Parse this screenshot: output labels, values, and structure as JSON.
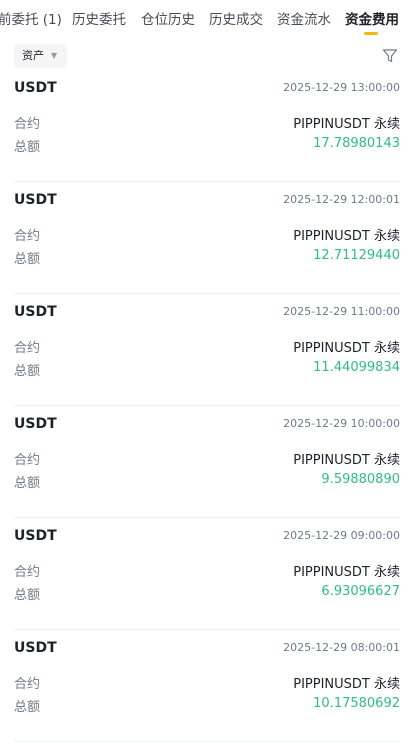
{
  "tabs": [
    {
      "label": "前委托 (1)"
    },
    {
      "label": "历史委托"
    },
    {
      "label": "仓位历史"
    },
    {
      "label": "历史成交"
    },
    {
      "label": "资金流水"
    },
    {
      "label": "资金费用",
      "active": true
    }
  ],
  "filter": {
    "label": "资产"
  },
  "labels": {
    "contract": "合约",
    "total": "总额"
  },
  "records": [
    {
      "asset": "USDT",
      "time": "2025-12-29 13:00:00",
      "contract": "PIPPINUSDT 永续",
      "amount": "17.78980143"
    },
    {
      "asset": "USDT",
      "time": "2025-12-29 12:00:01",
      "contract": "PIPPINUSDT 永续",
      "amount": "12.71129440"
    },
    {
      "asset": "USDT",
      "time": "2025-12-29 11:00:00",
      "contract": "PIPPINUSDT 永续",
      "amount": "11.44099834"
    },
    {
      "asset": "USDT",
      "time": "2025-12-29 10:00:00",
      "contract": "PIPPINUSDT 永续",
      "amount": "9.59880890"
    },
    {
      "asset": "USDT",
      "time": "2025-12-29 09:00:00",
      "contract": "PIPPINUSDT 永续",
      "amount": "6.93096627"
    },
    {
      "asset": "USDT",
      "time": "2025-12-29 08:00:01",
      "contract": "PIPPINUSDT 永续",
      "amount": "10.17580692"
    }
  ],
  "colors": {
    "accent": "#f0b90b",
    "positive": "#2ebd85"
  }
}
